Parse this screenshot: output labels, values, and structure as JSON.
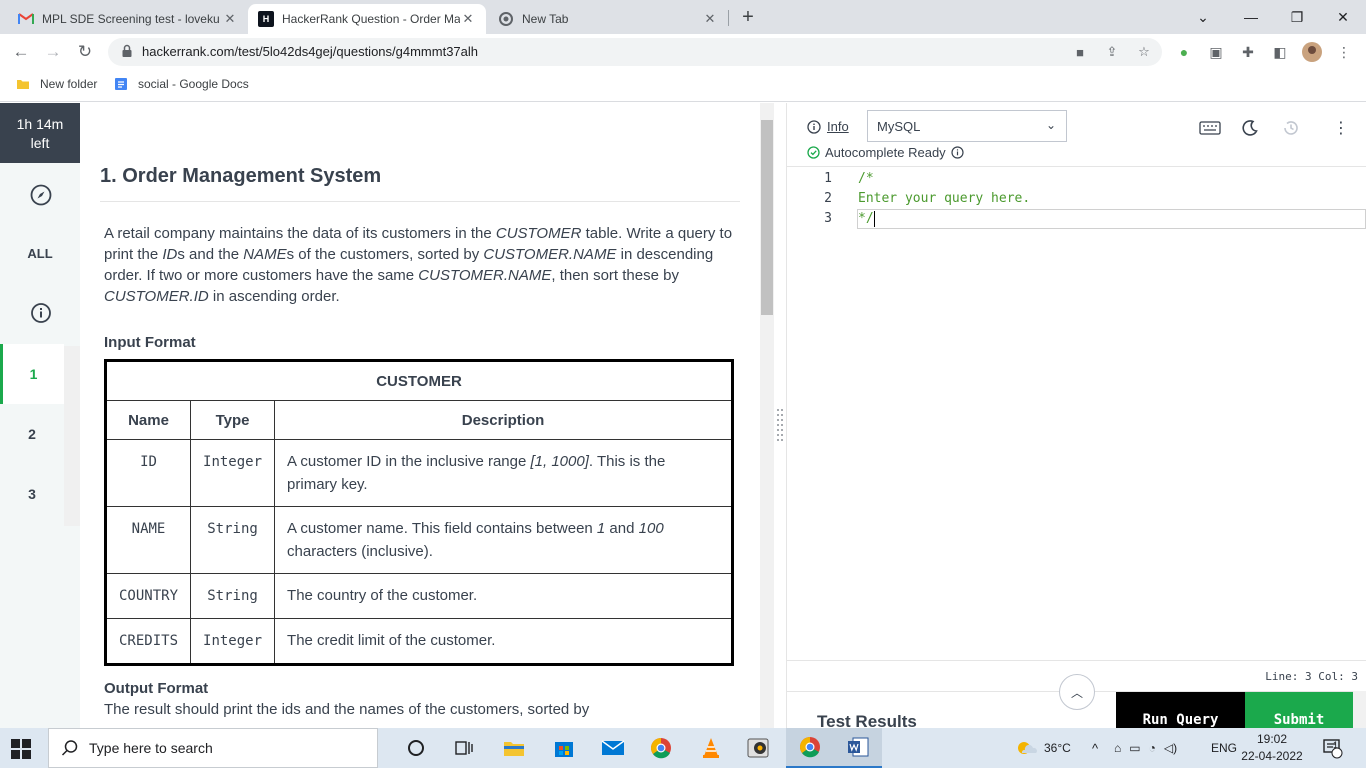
{
  "browser": {
    "tabs": [
      {
        "title": "MPL SDE Screening test - loveku",
        "close": "✕"
      },
      {
        "title": "HackerRank Question - Order Ma",
        "close": "✕"
      },
      {
        "title": "New Tab",
        "close": "✕"
      }
    ],
    "new_tab": "+",
    "url": "hackerrank.com/test/5lo42ds4gej/questions/g4mmmt37alh",
    "bookmarks": [
      "New folder",
      "social - Google Docs"
    ]
  },
  "rail": {
    "timer_line1": "1h 14m",
    "timer_line2": "left",
    "all_label": "ALL",
    "questions": [
      "1",
      "2",
      "3"
    ]
  },
  "question": {
    "title": "1. Order Management System",
    "intro": [
      {
        "t": "A retail company maintains the data of its customers in the ",
        "i": false
      },
      {
        "t": "CUSTOMER",
        "i": true
      },
      {
        "t": " table. Write a query to print the ",
        "i": false
      },
      {
        "t": "ID",
        "i": true
      },
      {
        "t": "s and the ",
        "i": false
      },
      {
        "t": "NAME",
        "i": true
      },
      {
        "t": "s of the customers, sorted by ",
        "i": false
      },
      {
        "t": "CUSTOMER.NAME",
        "i": true
      },
      {
        "t": " in descending order. If two or more customers have the same ",
        "i": false
      },
      {
        "t": "CUSTOMER.NAME",
        "i": true
      },
      {
        "t": ", then sort these by ",
        "i": false
      },
      {
        "t": "CUSTOMER.ID",
        "i": true
      },
      {
        "t": " in ascending order.",
        "i": false
      }
    ],
    "input_heading": "Input Format",
    "table_caption": "CUSTOMER",
    "table_headers": [
      "Name",
      "Type",
      "Description"
    ],
    "table_rows": [
      {
        "name": "ID",
        "type": "Integer",
        "desc": [
          {
            "t": "A customer ID in the inclusive range ",
            "i": false
          },
          {
            "t": "[1, 1000]",
            "i": true
          },
          {
            "t": ". This is the primary key.",
            "i": false
          }
        ]
      },
      {
        "name": "NAME",
        "type": "String",
        "desc": [
          {
            "t": "A customer name. This field contains between ",
            "i": false
          },
          {
            "t": "1",
            "i": true
          },
          {
            "t": " and ",
            "i": false
          },
          {
            "t": "100",
            "i": true
          },
          {
            "t": " characters (inclusive).",
            "i": false
          }
        ]
      },
      {
        "name": "COUNTRY",
        "type": "String",
        "desc": [
          {
            "t": "The country of the customer.",
            "i": false
          }
        ]
      },
      {
        "name": "CREDITS",
        "type": "Integer",
        "desc": [
          {
            "t": "The credit limit of the customer.",
            "i": false
          }
        ]
      }
    ],
    "output_heading": "Output Format",
    "output_text": "The result should print the ids and the names of the customers, sorted by"
  },
  "editor": {
    "info_label": "Info",
    "language": "MySQL",
    "autocomplete": "Autocomplete Ready",
    "lines": [
      {
        "n": "1",
        "text": "/*"
      },
      {
        "n": "2",
        "text": "Enter your query here."
      },
      {
        "n": "3",
        "text": "*/"
      }
    ],
    "status": "Line: 3 Col: 3",
    "test_results": "Test Results",
    "run_label": "Run Query",
    "submit_label": "Submit"
  },
  "taskbar": {
    "search_placeholder": "Type here to search",
    "weather": "36°C",
    "lang": "ENG",
    "time": "19:02",
    "date": "22-04-2022",
    "notifications": "1"
  },
  "colors": {
    "hr_dark": "#39424e",
    "hr_green": "#1ba94c",
    "code_comment": "#4b9a2e"
  }
}
